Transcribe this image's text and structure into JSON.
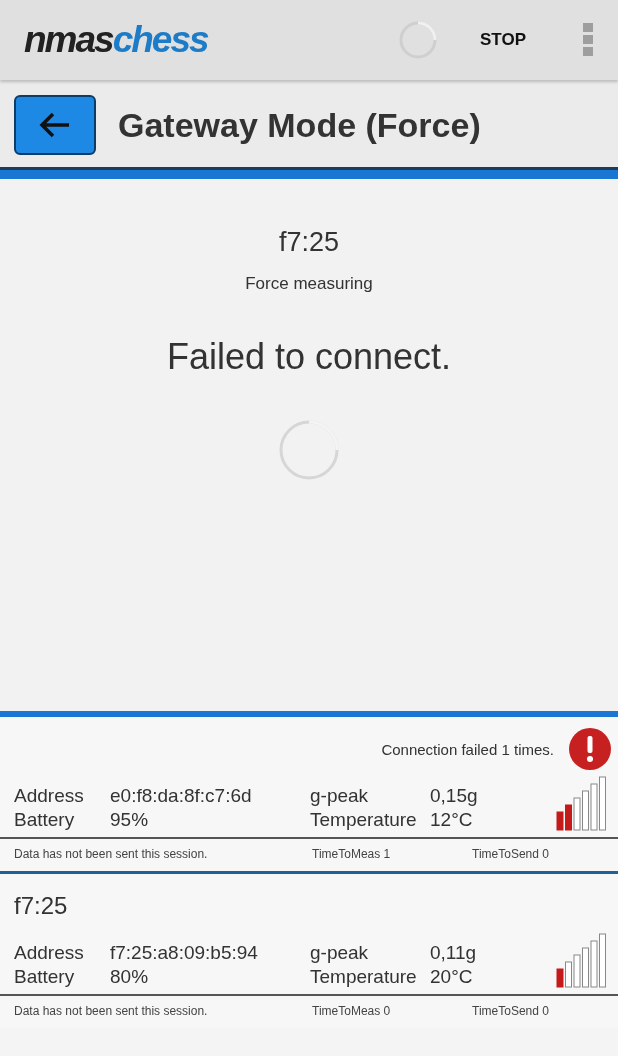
{
  "app_bar": {
    "logo": [
      "nmas",
      "chess"
    ],
    "busy": true,
    "action": "STOP"
  },
  "header": {
    "title": "Gateway Mode (Force)"
  },
  "main": {
    "device": "f7:25",
    "mode": "Force measuring",
    "message": "Failed to connect.",
    "busy": true
  },
  "devices": [
    {
      "status": "Connection failed 1 times.",
      "error": true,
      "fields": [
        {
          "label": "Address",
          "value": "e0:f8:da:8f:c7:6d"
        },
        {
          "label": "g-peak",
          "value": "0,15g"
        },
        {
          "label": "Battery",
          "value": "95%"
        },
        {
          "label": "Temperature",
          "value": "12°C"
        }
      ],
      "level": 0.33,
      "footer": [
        "Data has not been sent this session.",
        "TimeToMeas 1",
        "TimeToSend 0"
      ]
    },
    {
      "name": "f7:25",
      "error": false,
      "fields": [
        {
          "label": "Address",
          "value": "f7:25:a8:09:b5:94"
        },
        {
          "label": "g-peak",
          "value": "0,11g"
        },
        {
          "label": "Battery",
          "value": "80%"
        },
        {
          "label": "Temperature",
          "value": "20°C"
        }
      ],
      "level": 0.17,
      "footer": [
        "Data has not been sent this session.",
        "TimeToMeas 0",
        "TimeToSend 0"
      ]
    }
  ]
}
